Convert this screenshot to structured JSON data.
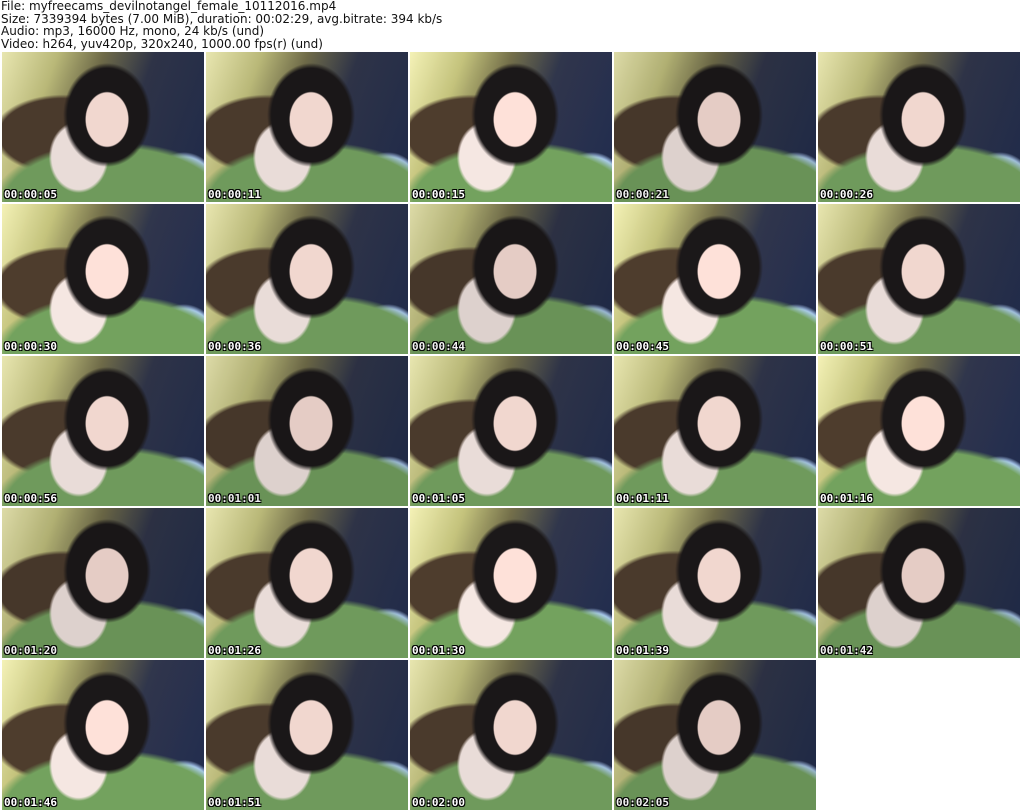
{
  "header": {
    "file": "File: myfreecams_devilnotangel_female_10112016.mp4",
    "size": "Size: 7339394 bytes (7.00 MiB), duration: 00:02:29, avg.bitrate: 394 kb/s",
    "audio": "Audio: mp3, 16000 Hz, mono, 24 kb/s (und)",
    "video": "Video: h264, yuv420p, 320x240, 1000.00 fps(r) (und)"
  },
  "thumbnails": [
    "00:00:05",
    "00:00:11",
    "00:00:15",
    "00:00:21",
    "00:00:26",
    "00:00:30",
    "00:00:36",
    "00:00:44",
    "00:00:45",
    "00:00:51",
    "00:00:56",
    "00:01:01",
    "00:01:05",
    "00:01:11",
    "00:01:16",
    "00:01:20",
    "00:01:26",
    "00:01:30",
    "00:01:39",
    "00:01:42",
    "00:01:46",
    "00:01:51",
    "00:02:00",
    "00:02:05"
  ]
}
